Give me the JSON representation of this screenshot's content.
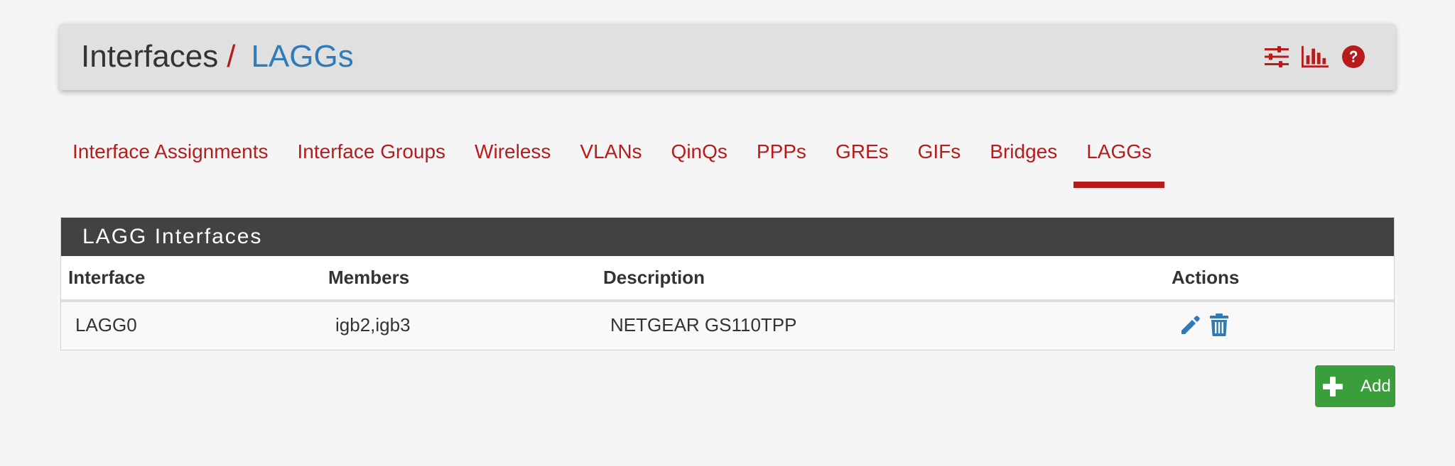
{
  "header": {
    "breadcrumb_root": "Interfaces",
    "breadcrumb_separator": "/",
    "breadcrumb_current": "LAGGs",
    "icons": [
      "sliders-icon",
      "bar-chart-icon",
      "help-icon"
    ]
  },
  "tabs": [
    {
      "label": "Interface Assignments",
      "active": false
    },
    {
      "label": "Interface Groups",
      "active": false
    },
    {
      "label": "Wireless",
      "active": false
    },
    {
      "label": "VLANs",
      "active": false
    },
    {
      "label": "QinQs",
      "active": false
    },
    {
      "label": "PPPs",
      "active": false
    },
    {
      "label": "GREs",
      "active": false
    },
    {
      "label": "GIFs",
      "active": false
    },
    {
      "label": "Bridges",
      "active": false
    },
    {
      "label": "LAGGs",
      "active": true
    }
  ],
  "panel": {
    "title": "LAGG Interfaces",
    "columns": {
      "interface": "Interface",
      "members": "Members",
      "description": "Description",
      "actions": "Actions"
    },
    "rows": [
      {
        "interface": "LAGG0",
        "members": "igb2,igb3",
        "description": "NETGEAR GS110TPP",
        "actions": [
          "edit-icon",
          "delete-icon"
        ]
      }
    ]
  },
  "add_button": {
    "label": "Add",
    "icon": "plus-icon"
  },
  "colors": {
    "brand_red": "#b71c1c",
    "link_blue": "#2f7ab8",
    "panel_heading": "#424242",
    "add_green": "#3a9f3a",
    "background": "#f5f5f5",
    "header_bg": "#e0e0e0"
  }
}
